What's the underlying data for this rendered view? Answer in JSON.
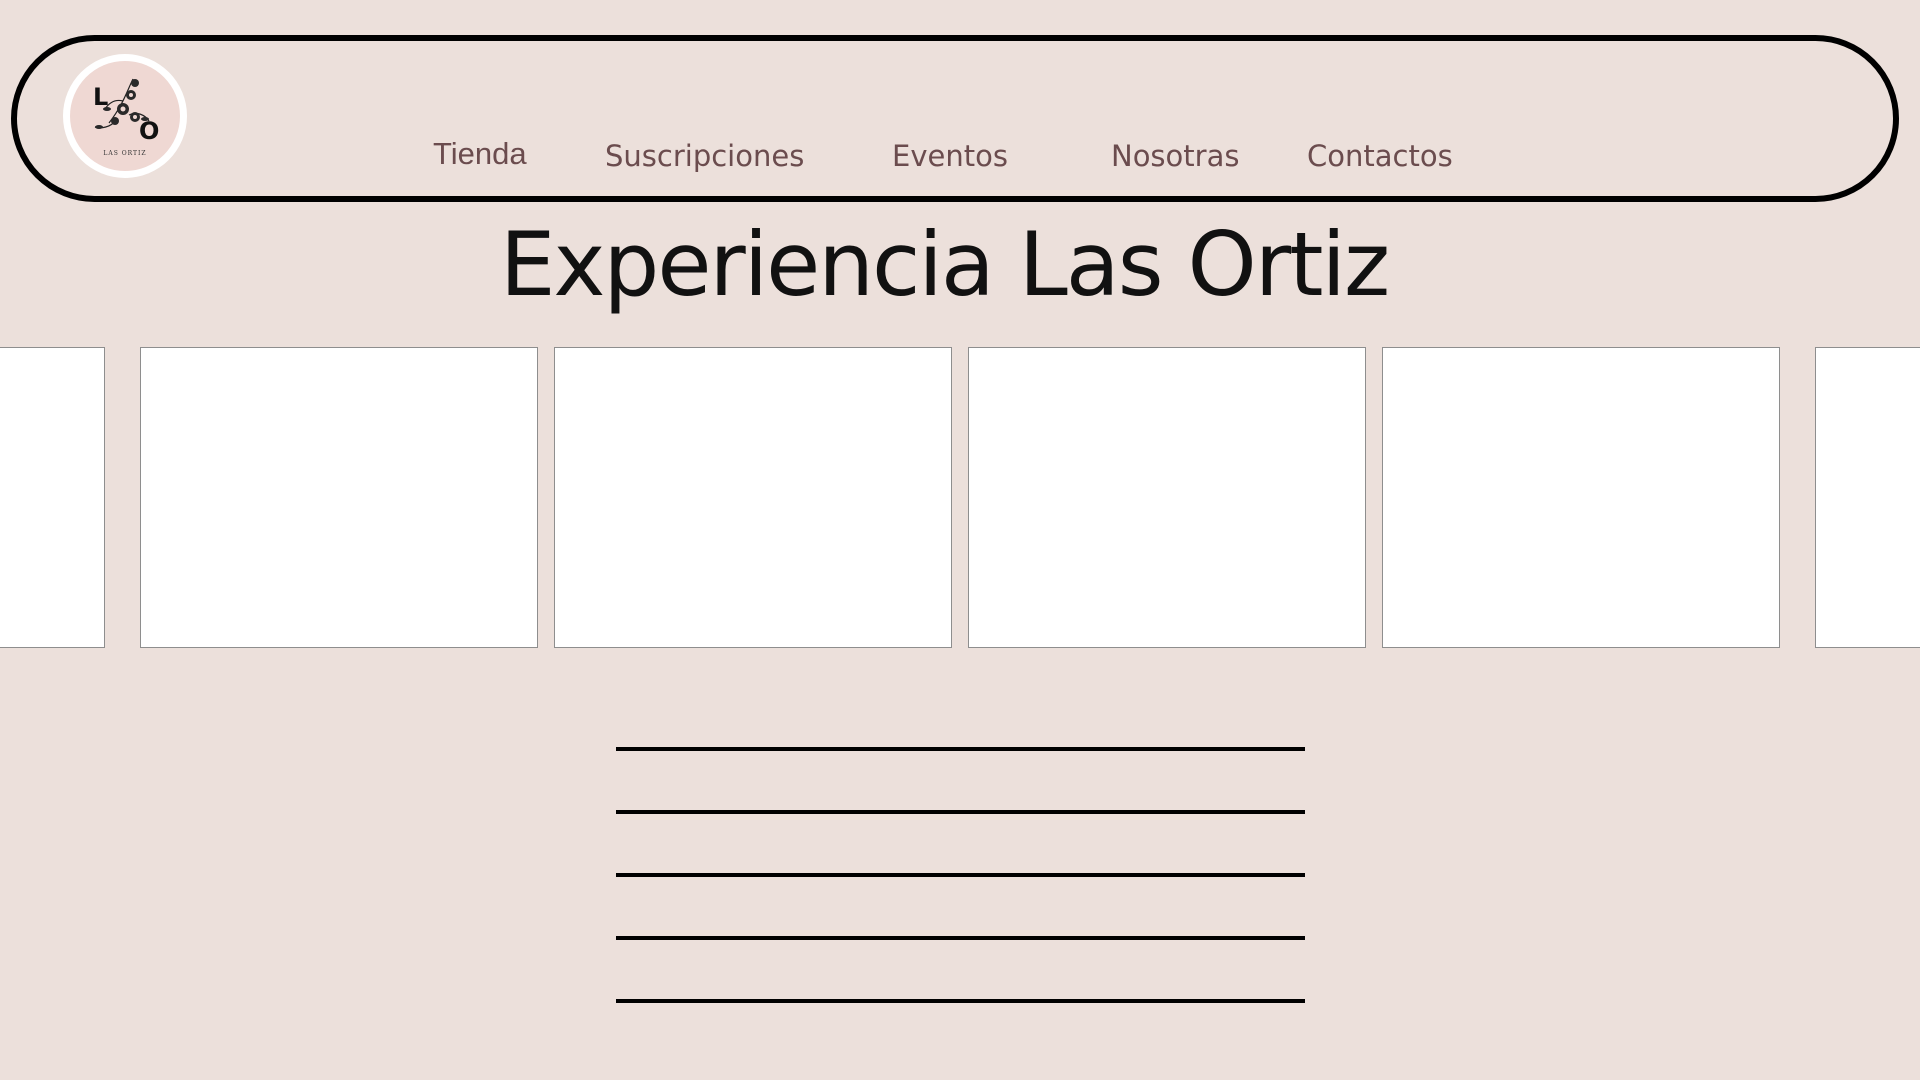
{
  "logo": {
    "letter_left": "L",
    "letter_right": "O",
    "brand_text": "LAS ORTIZ",
    "icon": "flower-icon"
  },
  "nav": {
    "items": [
      {
        "label": "Tienda"
      },
      {
        "label": "Suscripciones"
      },
      {
        "label": "Eventos"
      },
      {
        "label": "Nosotras"
      },
      {
        "label": "Contactos"
      }
    ]
  },
  "main": {
    "title": "Experiencia Las Ortiz"
  },
  "colors": {
    "background": "#ece0db",
    "nav_text": "#6b4c4e",
    "border": "#000000",
    "card": "#ffffff",
    "logo_inner": "#efd8d3"
  }
}
